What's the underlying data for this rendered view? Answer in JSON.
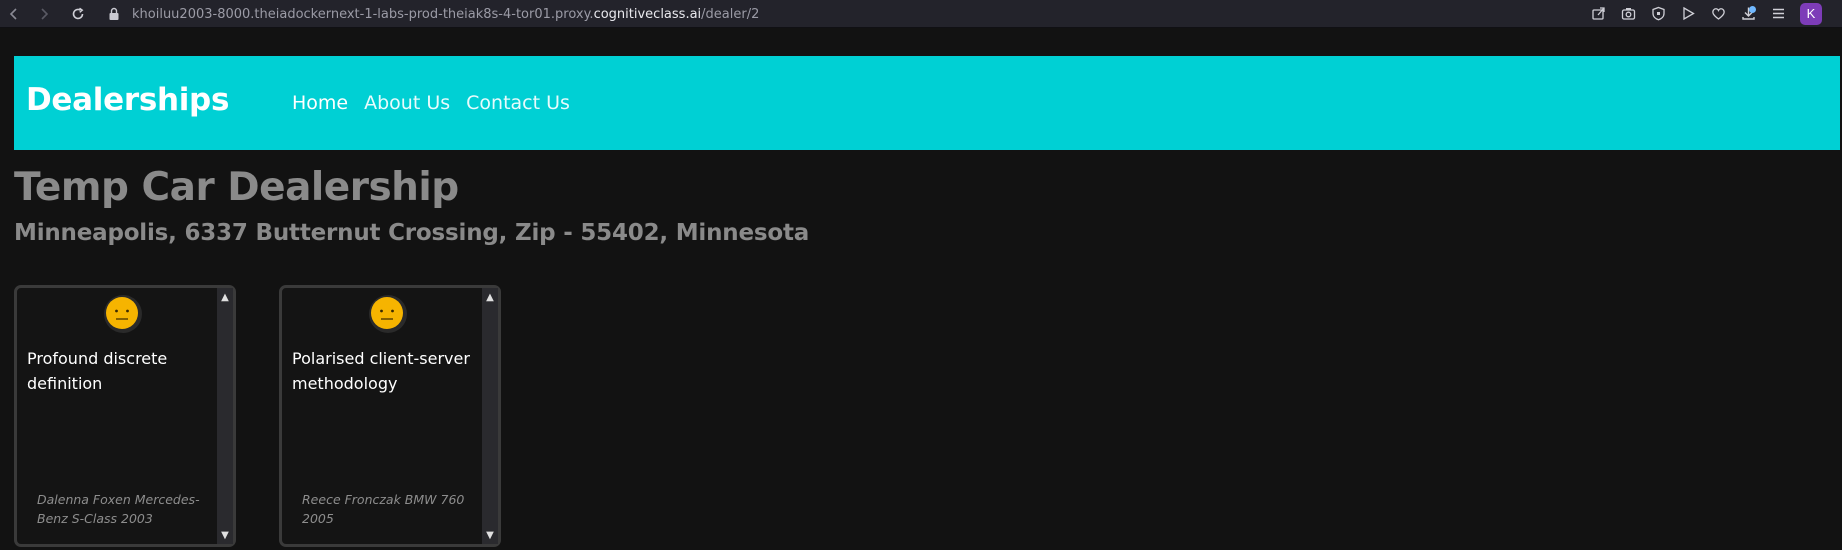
{
  "browser": {
    "url_prefix": "khoiluu2003-8000.theiadockernext-1-labs-prod-theiak8s-4-tor01.proxy.",
    "url_domain": "cognitiveclass.ai",
    "url_suffix": "/dealer/2",
    "profile_initial": "K"
  },
  "nav": {
    "brand": "Dealerships",
    "links": [
      "Home",
      "About Us",
      "Contact Us"
    ],
    "color": "#00d0d4"
  },
  "dealer": {
    "name": "Temp Car Dealership",
    "address": "Minneapolis, 6337 Butternut Crossing, Zip - 55402, Minnesota"
  },
  "reviews": [
    {
      "sentiment_icon": "neutral-face-icon",
      "text": "Profound discrete definition",
      "reviewer": "Dalenna Foxen Mercedes-Benz S-Class 2003"
    },
    {
      "sentiment_icon": "neutral-face-icon",
      "text": "Polarised client-server methodology",
      "reviewer": "Reece Fronczak BMW 760 2005"
    }
  ]
}
